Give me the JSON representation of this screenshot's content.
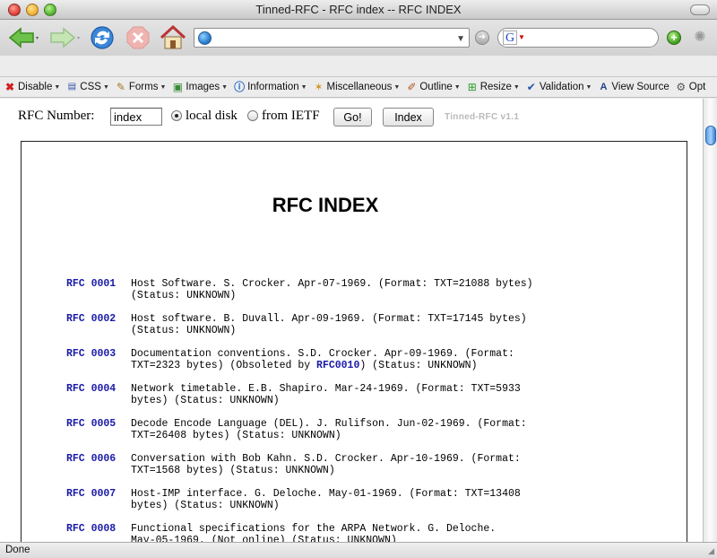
{
  "window": {
    "title": "Tinned-RFC - RFC index -- RFC INDEX"
  },
  "navbar": {
    "url_value": "",
    "search_value": "",
    "search_engine_glyph": "G"
  },
  "devbar": {
    "items": [
      {
        "label": "Disable",
        "icon": "disable-icon"
      },
      {
        "label": "CSS",
        "icon": "css-icon"
      },
      {
        "label": "Forms",
        "icon": "forms-icon"
      },
      {
        "label": "Images",
        "icon": "images-icon"
      },
      {
        "label": "Information",
        "icon": "information-icon"
      },
      {
        "label": "Miscellaneous",
        "icon": "miscellaneous-icon"
      },
      {
        "label": "Outline",
        "icon": "outline-icon"
      },
      {
        "label": "Resize",
        "icon": "resize-icon"
      },
      {
        "label": "Validation",
        "icon": "validation-icon"
      },
      {
        "label": "View Source",
        "icon": "view-source-icon"
      },
      {
        "label": "Opt",
        "icon": "options-icon"
      }
    ]
  },
  "form": {
    "label": "RFC Number:",
    "input_value": "index",
    "radio_local": "local disk",
    "radio_ietf": "from IETF",
    "go_label": "Go!",
    "index_label": "Index",
    "version": "Tinned-RFC v1.1"
  },
  "doc": {
    "title": "RFC INDEX",
    "entries": [
      {
        "num": "RFC 0001",
        "text": "Host Software. S. Crocker. Apr-07-1969. (Format: TXT=21088 bytes)\n(Status: UNKNOWN)"
      },
      {
        "num": "RFC 0002",
        "text": "Host software. B. Duvall. Apr-09-1969. (Format: TXT=17145 bytes)\n(Status: UNKNOWN)"
      },
      {
        "num": "RFC 0003",
        "text_before": "Documentation conventions. S.D. Crocker. Apr-09-1969. (Format:\nTXT=2323 bytes) (Obsoleted by ",
        "link": "RFC0010",
        "text_after": ") (Status: UNKNOWN)"
      },
      {
        "num": "RFC 0004",
        "text": "Network timetable. E.B. Shapiro. Mar-24-1969. (Format: TXT=5933\nbytes) (Status: UNKNOWN)"
      },
      {
        "num": "RFC 0005",
        "text": "Decode Encode Language (DEL). J. Rulifson. Jun-02-1969. (Format:\nTXT=26408 bytes) (Status: UNKNOWN)"
      },
      {
        "num": "RFC 0006",
        "text": "Conversation with Bob Kahn. S.D. Crocker. Apr-10-1969. (Format:\nTXT=1568 bytes) (Status: UNKNOWN)"
      },
      {
        "num": "RFC 0007",
        "text": "Host-IMP interface. G. Deloche. May-01-1969. (Format: TXT=13408\nbytes) (Status: UNKNOWN)"
      },
      {
        "num": "RFC 0008",
        "text": "Functional specifications for the ARPA Network. G. Deloche.\nMay-05-1969. (Not online) (Status: UNKNOWN)"
      }
    ]
  },
  "status": {
    "text": "Done"
  },
  "colors": {
    "link": "#1a1aa8",
    "version_gray": "#b9b9b9"
  }
}
